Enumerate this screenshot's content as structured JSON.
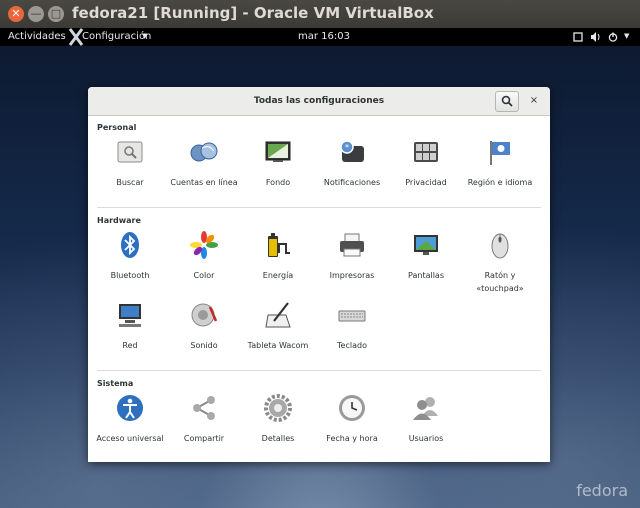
{
  "host": {
    "title": "fedora21 [Running] - Oracle VM VirtualBox",
    "close": "✕",
    "minimize": "—",
    "maximize": "□"
  },
  "topbar": {
    "activities": "Actividades",
    "app_menu": "Configuración",
    "clock": "mar 16:03"
  },
  "window": {
    "title": "Todas las configuraciones",
    "close": "×"
  },
  "sections": [
    {
      "title": "Personal",
      "items": [
        {
          "label": "Buscar",
          "icon": "search-settings-icon"
        },
        {
          "label": "Cuentas en línea",
          "icon": "online-accounts-icon"
        },
        {
          "label": "Fondo",
          "icon": "background-icon"
        },
        {
          "label": "Notificaciones",
          "icon": "notifications-icon"
        },
        {
          "label": "Privacidad",
          "icon": "privacy-icon"
        },
        {
          "label": "Región e idioma",
          "icon": "region-flag-icon"
        }
      ]
    },
    {
      "title": "Hardware",
      "items": [
        {
          "label": "Bluetooth",
          "icon": "bluetooth-icon"
        },
        {
          "label": "Color",
          "icon": "color-icon"
        },
        {
          "label": "Energía",
          "icon": "power-icon"
        },
        {
          "label": "Impresoras",
          "icon": "printer-icon"
        },
        {
          "label": "Pantallas",
          "icon": "displays-icon"
        },
        {
          "label": "Ratón y «touchpad»",
          "icon": "mouse-icon"
        },
        {
          "label": "Red",
          "icon": "network-icon"
        },
        {
          "label": "Sonido",
          "icon": "sound-icon"
        },
        {
          "label": "Tableta Wacom",
          "icon": "tablet-icon"
        },
        {
          "label": "Teclado",
          "icon": "keyboard-icon"
        }
      ]
    },
    {
      "title": "Sistema",
      "items": [
        {
          "label": "Acceso universal",
          "icon": "universal-access-icon"
        },
        {
          "label": "Compartir",
          "icon": "share-icon"
        },
        {
          "label": "Detalles",
          "icon": "details-gear-icon"
        },
        {
          "label": "Fecha y hora",
          "icon": "clock-icon"
        },
        {
          "label": "Usuarios",
          "icon": "users-icon"
        }
      ]
    }
  ],
  "watermark": "fedora"
}
